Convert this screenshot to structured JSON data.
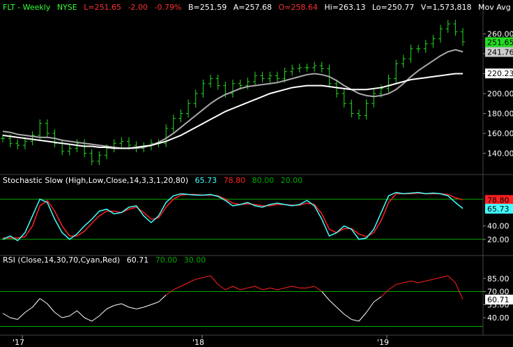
{
  "colors": {
    "background": "#000000",
    "up_bar": "#22dd22",
    "ma_fast": "#aaaaaa",
    "ma_slow": "#ffffff",
    "stoch_k": "#44ffff",
    "stoch_d": "#ff2020",
    "rsi_normal": "#ffffff",
    "rsi_overbought": "#ff2020",
    "ref_line": "#00aa00",
    "price_red": "#ff3030",
    "price_green": "#33ff33",
    "label_white": "#ffffff"
  },
  "header": {
    "symbol": "FLT - Weekly",
    "exchange": "NYSE",
    "last": "L=251.65",
    "change": "-2.00",
    "change_pct": "-0.79%",
    "bid": "B=251.59",
    "ask": "A=257.68",
    "open": "O=258.64",
    "high": "Hi=263.13",
    "low": "Lo=250.77",
    "volume": "V=1,573,818",
    "study": "Mov Avg 2 Lines (Close"
  },
  "price_axis": {
    "ticks": [
      "260.00",
      "240.00",
      "220.00",
      "200.00",
      "180.00",
      "160.00",
      "140.00"
    ],
    "tags": {
      "last": "251.65",
      "ma_fast": "241.76",
      "ma_slow": "220.23"
    }
  },
  "stoch": {
    "title": "Stochastic Slow (High,Low,Close,14,3,3,1,20,80)",
    "k_value": "65.73",
    "d_value": "78.80",
    "upper": "80.00",
    "lower": "20.00",
    "ticks": [
      "40.00",
      "20.00"
    ],
    "tags": {
      "d": "78.80",
      "k": "65.73"
    }
  },
  "rsi": {
    "title": "RSI (Close,14,30,70,Cyan,Red)",
    "value": "60.71",
    "upper": "70.00",
    "lower": "30.00",
    "ticks": [
      "85.00",
      "70.00",
      "55.00",
      "40.00"
    ],
    "tag": "60.71"
  },
  "time_axis": {
    "labels": [
      "'17",
      "'18",
      "'19"
    ]
  },
  "chart_data": [
    {
      "type": "candlestick",
      "title": "FLT - Weekly",
      "ylim": [
        120,
        280
      ],
      "x": [
        0,
        4,
        8,
        12,
        16,
        20,
        24,
        28,
        32,
        36,
        40,
        44,
        48,
        52,
        56,
        60,
        64,
        68,
        72,
        76,
        80,
        84,
        88,
        92,
        96,
        100,
        104,
        108,
        112,
        116,
        120,
        124,
        128,
        132,
        136,
        140,
        144,
        148,
        152,
        156,
        160,
        164,
        168,
        172,
        176,
        180,
        184,
        188,
        192,
        196,
        200,
        204,
        208,
        212,
        216,
        220,
        224,
        228,
        232,
        236,
        240,
        244,
        248
      ],
      "x_unit": "weeks since first bar",
      "series": [
        {
          "name": "close",
          "values": [
            155,
            150,
            148,
            152,
            158,
            170,
            160,
            150,
            142,
            145,
            150,
            140,
            132,
            138,
            145,
            150,
            152,
            148,
            145,
            147,
            150,
            150,
            165,
            175,
            180,
            190,
            200,
            210,
            215,
            208,
            200,
            210,
            208,
            212,
            218,
            215,
            218,
            215,
            222,
            225,
            226,
            226,
            228,
            225,
            210,
            200,
            190,
            180,
            178,
            190,
            200,
            205,
            215,
            230,
            235,
            245,
            245,
            250,
            255,
            265,
            270,
            262,
            252
          ]
        },
        {
          "name": "Mov Avg fast",
          "values": [
            162,
            161,
            159,
            158,
            157,
            156,
            156,
            155,
            153,
            152,
            151,
            150,
            149,
            148,
            147,
            146,
            145,
            145,
            145,
            146,
            148,
            151,
            155,
            160,
            166,
            172,
            178,
            184,
            190,
            195,
            199,
            202,
            205,
            207,
            208,
            209,
            210,
            211,
            213,
            215,
            217,
            219,
            220,
            219,
            217,
            213,
            208,
            204,
            200,
            198,
            197,
            198,
            200,
            204,
            210,
            217,
            223,
            228,
            233,
            238,
            242,
            244,
            242
          ]
        },
        {
          "name": "Mov Avg slow",
          "values": [
            158,
            157,
            156,
            155,
            154,
            153,
            152,
            151,
            150,
            149,
            148,
            147,
            147,
            146,
            146,
            145,
            145,
            145,
            146,
            147,
            148,
            150,
            152,
            155,
            158,
            162,
            166,
            170,
            174,
            178,
            182,
            185,
            188,
            191,
            194,
            197,
            200,
            202,
            204,
            206,
            207,
            208,
            208,
            208,
            207,
            206,
            205,
            204,
            204,
            204,
            205,
            206,
            208,
            210,
            212,
            214,
            215,
            216,
            217,
            218,
            219,
            220,
            220
          ]
        }
      ],
      "tags": {
        "last": 251.65,
        "ma_fast": 241.76,
        "ma_slow": 220.23
      }
    },
    {
      "type": "line",
      "title": "Stochastic Slow (High,Low,Close,14,3,3,1,20,80)",
      "ylim": [
        0,
        100
      ],
      "ref_lines": [
        80,
        20
      ],
      "series": [
        {
          "name": "%K",
          "values": [
            20,
            25,
            18,
            30,
            55,
            80,
            75,
            50,
            30,
            20,
            28,
            40,
            50,
            62,
            65,
            58,
            60,
            68,
            70,
            55,
            45,
            55,
            75,
            85,
            88,
            87,
            86,
            86,
            87,
            84,
            78,
            70,
            72,
            75,
            70,
            68,
            72,
            74,
            72,
            70,
            72,
            78,
            70,
            50,
            25,
            30,
            40,
            35,
            20,
            22,
            35,
            60,
            85,
            90,
            88,
            89,
            90,
            88,
            89,
            88,
            85,
            75,
            66
          ]
        },
        {
          "name": "%D",
          "values": [
            22,
            22,
            22,
            24,
            40,
            70,
            78,
            62,
            40,
            25,
            25,
            32,
            44,
            55,
            62,
            62,
            60,
            65,
            68,
            60,
            50,
            52,
            68,
            80,
            86,
            87,
            87,
            86,
            86,
            85,
            80,
            74,
            72,
            73,
            72,
            70,
            70,
            72,
            72,
            71,
            71,
            74,
            72,
            58,
            35,
            30,
            36,
            36,
            28,
            24,
            30,
            48,
            75,
            88,
            88,
            88,
            89,
            88,
            88,
            88,
            87,
            82,
            79
          ]
        }
      ],
      "values_last": {
        "%K": 65.73,
        "%D": 78.8
      }
    },
    {
      "type": "line",
      "title": "RSI (Close,14,30,70,Cyan,Red)",
      "ylim": [
        20,
        100
      ],
      "ref_lines": [
        70,
        30
      ],
      "series": [
        {
          "name": "RSI",
          "values": [
            45,
            40,
            38,
            46,
            52,
            62,
            56,
            46,
            40,
            42,
            48,
            40,
            36,
            42,
            50,
            54,
            56,
            52,
            50,
            52,
            55,
            58,
            66,
            72,
            76,
            80,
            84,
            86,
            88,
            78,
            72,
            76,
            72,
            74,
            76,
            72,
            74,
            72,
            74,
            76,
            74,
            74,
            76,
            70,
            60,
            52,
            44,
            38,
            36,
            46,
            58,
            64,
            72,
            78,
            80,
            82,
            80,
            82,
            84,
            86,
            88,
            80,
            61
          ]
        }
      ],
      "last": 60.71
    }
  ]
}
